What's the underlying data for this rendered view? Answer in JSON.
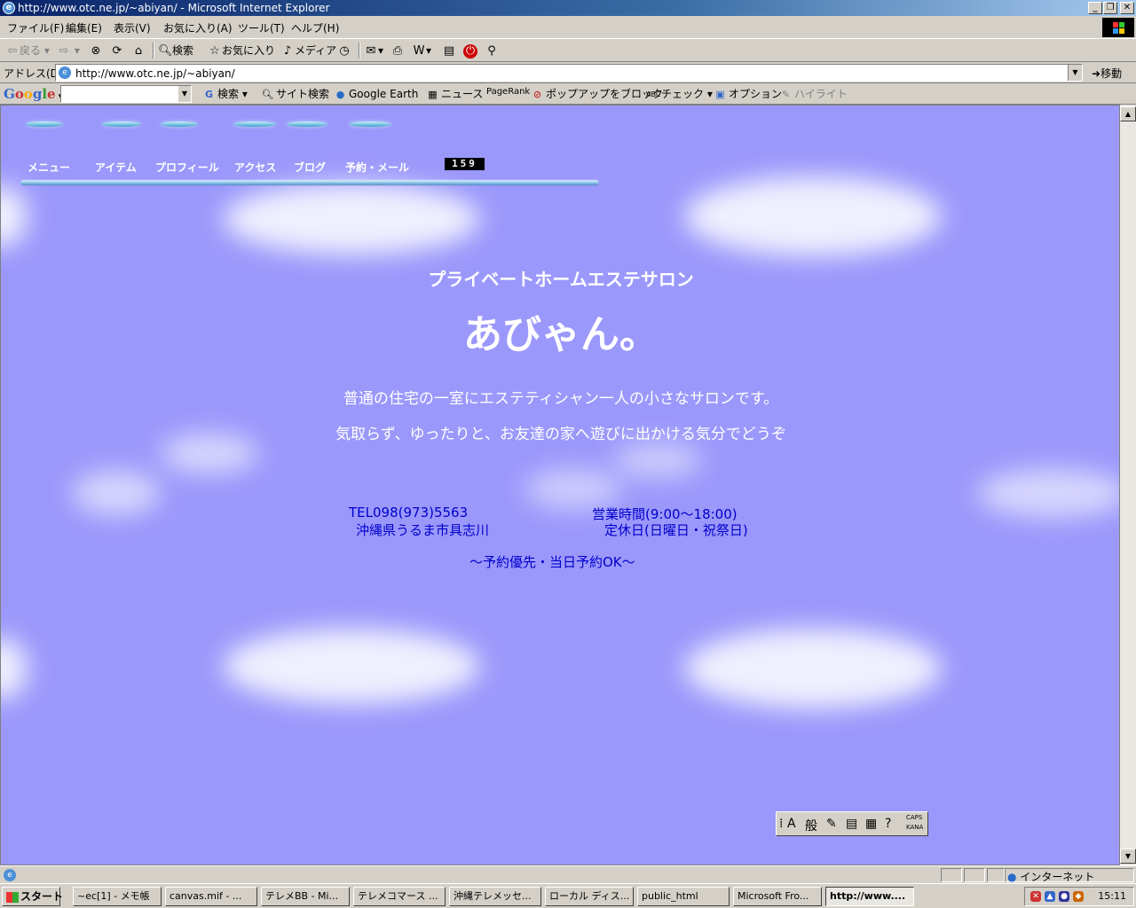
{
  "window": {
    "title": "http://www.otc.ne.jp/~abiyan/ - Microsoft Internet Explorer"
  },
  "menu": {
    "items": [
      "ファイル(F)",
      "編集(E)",
      "表示(V)",
      "お気に入り(A)",
      "ツール(T)",
      "ヘルプ(H)"
    ]
  },
  "toolbar": {
    "back": "戻る",
    "search": "検索",
    "favorites": "お気に入り",
    "media": "メディア"
  },
  "address": {
    "label": "アドレス(D)",
    "url": "http://www.otc.ne.jp/~abiyan/",
    "go": "移動"
  },
  "googlebar": {
    "logo": "Google",
    "search": "検索",
    "site_search": "サイト検索",
    "earth": "Google Earth",
    "news": "ニュース",
    "pagerank": "PageRank",
    "popup": "ポップアップをブロック",
    "check": "チェック",
    "options": "オプション",
    "highlight": "ハイライト"
  },
  "page": {
    "nav": [
      "メニュー",
      "アイテム",
      "プロフィール",
      "アクセス",
      "ブログ",
      "予約・メール"
    ],
    "counter": "159",
    "subtitle": "プライベートホームエステサロン",
    "title": "あびゃん。",
    "desc1": "普通の住宅の一室にエステティシャン一人の小さなサロンです。",
    "desc2": "気取らず、ゆったりと、お友達の家へ遊びに出かける気分でどうぞ",
    "tel": "TEL098(973)5563",
    "address": "沖縄県うるま市具志川",
    "hours": "営業時間(9:00〜18:00)",
    "closed": "定休日(日曜日・祝祭日)",
    "reservation": "〜予約優先・当日予約OK〜"
  },
  "ime": {
    "mode": "般",
    "caps": "CAPS",
    "kana": "KANA"
  },
  "status": {
    "zone": "インターネット"
  },
  "taskbar": {
    "start": "スタート",
    "tasks": [
      "~ec[1] - メモ帳",
      "canvas.mif - ...",
      "テレメBB - Mi...",
      "テレメコマース ...",
      "沖縄テレメッセ...",
      "ローカル ディス...",
      "public_html",
      "Microsoft Fro...",
      "http://www...."
    ],
    "clock": "15:11"
  },
  "colors": {
    "page_bg": "#9b98fb",
    "info_text": "#0000cc",
    "title_bar": "#0a246a"
  }
}
